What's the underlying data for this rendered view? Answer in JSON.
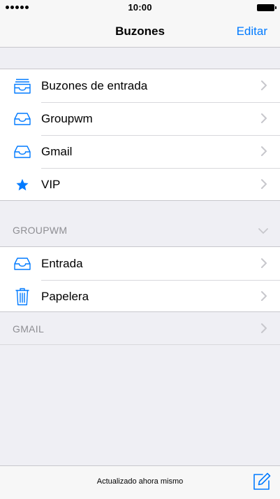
{
  "status_bar": {
    "time": "10:00"
  },
  "nav": {
    "title": "Buzones",
    "edit_label": "Editar"
  },
  "mailboxes": [
    {
      "label": "Buzones de entrada",
      "icon": "inbox-stack-icon"
    },
    {
      "label": "Groupwm",
      "icon": "inbox-icon"
    },
    {
      "label": "Gmail",
      "icon": "inbox-icon"
    },
    {
      "label": "VIP",
      "icon": "star-icon"
    }
  ],
  "groupwm_section": {
    "header": "GROUPWM",
    "items": [
      {
        "label": "Entrada",
        "icon": "inbox-icon"
      },
      {
        "label": "Papelera",
        "icon": "trash-icon"
      }
    ]
  },
  "gmail_section": {
    "header": "GMAIL"
  },
  "toolbar": {
    "status": "Actualizado ahora mismo"
  },
  "colors": {
    "accent": "#007aff",
    "secondary_text": "#8e8e93",
    "chevron": "#c7c7cc"
  }
}
